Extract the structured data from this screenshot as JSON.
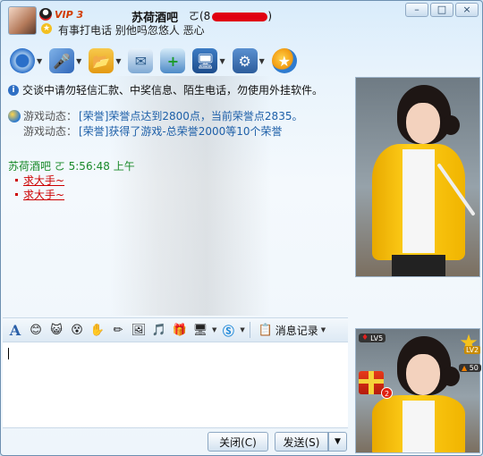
{
  "header": {
    "vip_label": "VIP 3",
    "nickname": "苏荷酒吧",
    "nick_extra": "ㄛ(8",
    "nick_extra_tail": ")",
    "signature": "有事打电话 别他吗忽悠人 恶心",
    "window_buttons": [
      "–",
      "□",
      "×"
    ]
  },
  "toolbar": {
    "items": [
      {
        "icon": "video-call-icon",
        "has_arrow": true
      },
      {
        "icon": "voice-call-icon",
        "has_arrow": true
      },
      {
        "icon": "send-file-icon",
        "has_arrow": true
      },
      {
        "icon": "send-sms-icon",
        "has_arrow": false
      },
      {
        "icon": "create-discussion-icon",
        "has_arrow": false
      },
      {
        "icon": "remote-assist-icon",
        "has_arrow": true
      },
      {
        "icon": "app-settings-icon",
        "has_arrow": true
      },
      {
        "icon": "qq-zone-icon",
        "has_arrow": false
      }
    ]
  },
  "chat": {
    "notice": "交谈中请勿轻信汇款、中奖信息、陌生电话，勿使用外挂软件。",
    "game_label_1": "游戏动态：",
    "game_text_1": "[荣誉]荣誉点达到2800点，当前荣誉点2835。",
    "game_label_2": "游戏动态：",
    "game_text_2": "[荣誉]获得了游戏-总荣誉2000等10个荣誉",
    "sender_line": "苏荷酒吧  ㄛ  5:56:48 上午",
    "messages": [
      "求大手~",
      "求大手~"
    ]
  },
  "format_bar": {
    "history_label": "消息记录"
  },
  "buttons": {
    "close_label": "关闭(C)",
    "send_label": "发送(S)",
    "send_arrow": "▼"
  },
  "side": {
    "level_badge": "LV5",
    "level2_badge": "LV2",
    "score_badge": "50",
    "gift_count": "2"
  },
  "colors": {
    "accent": "#2f6fc4",
    "message_red": "#cc0000",
    "sender_green": "#1a8a2a",
    "game_blue": "#1d5fa8",
    "vip_orange": "#d23b00"
  }
}
